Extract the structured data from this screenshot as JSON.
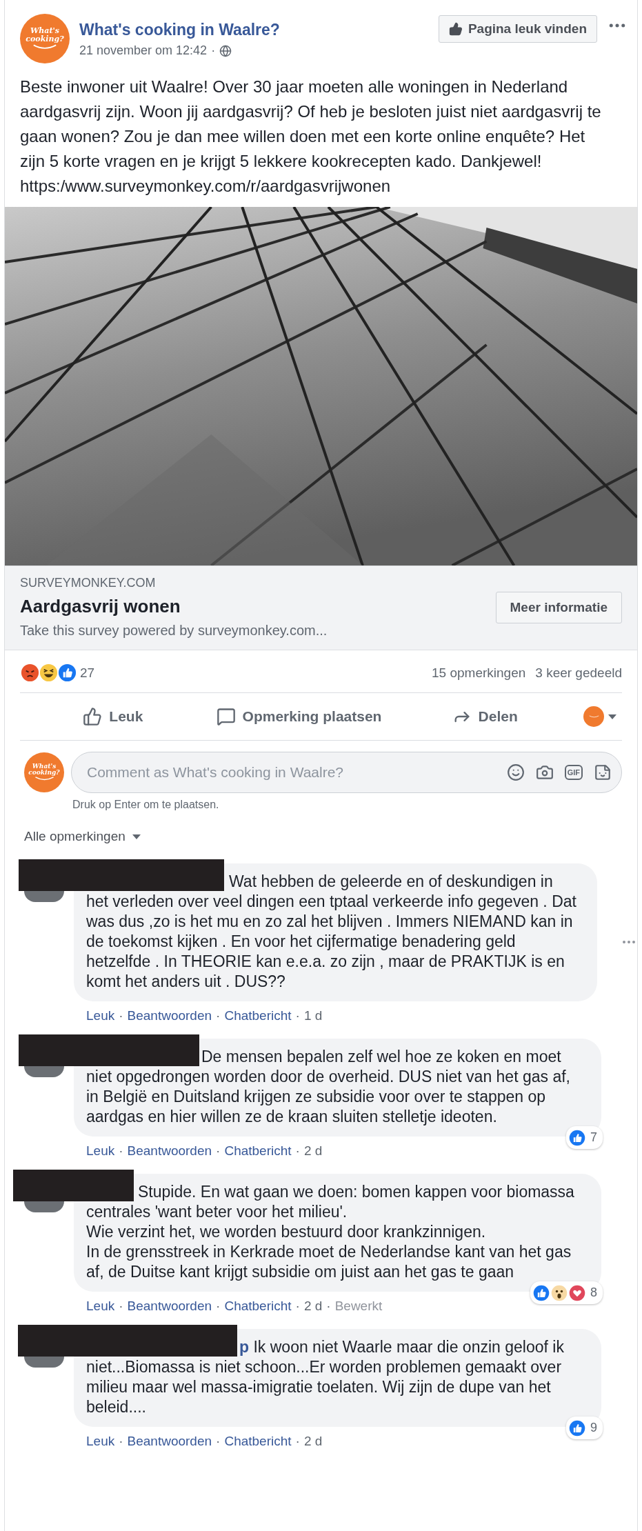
{
  "post": {
    "page_name": "What's cooking in Waalre?",
    "avatar_text": "What's cooking?",
    "date": "21 november om 12:42",
    "separator": "·",
    "like_page_button": "Pagina leuk vinden",
    "text": "Beste inwoner uit Waalre! Over 30 jaar moeten alle woningen in Nederland aardgasvrij zijn. Woon jij aardgasvrij? Of heb je besloten juist niet aardgasvrij te gaan wonen? Zou je dan mee willen doen met een korte online enquête? Het zijn 5 korte vragen en je krijgt 5 lekkere kookrecepten kado. Dankjewel!",
    "url": "https:/www.surveymonkey.com/r/aardgasvrijwonen",
    "link_preview": {
      "domain": "SURVEYMONKEY.COM",
      "title": "Aardgasvrij wonen",
      "description": "Take this survey powered by surveymonkey.com...",
      "button": "Meer informatie"
    },
    "reactions": {
      "kinds": [
        {
          "kind": "angry"
        },
        {
          "kind": "haha"
        },
        {
          "kind": "like"
        }
      ],
      "count": "27"
    },
    "comments_count": "15 opmerkingen",
    "shares_count": "3 keer gedeeld",
    "actions": [
      {
        "kind": "like",
        "label": "Leuk"
      },
      {
        "kind": "comment",
        "label": "Opmerking plaatsen"
      },
      {
        "kind": "share",
        "label": "Delen"
      }
    ]
  },
  "composer": {
    "avatar_text": "What's cooking?",
    "placeholder": "Comment as What's cooking in Waalre?",
    "tools": [
      {
        "kind": "emoji"
      },
      {
        "kind": "camera"
      },
      {
        "kind": "gif",
        "label": "GIF"
      },
      {
        "kind": "sticker"
      }
    ],
    "hint": "Druk op Enter om te plaatsen."
  },
  "filter": {
    "label": "Alle opmerkingen"
  },
  "comments": [
    {
      "redacted": true,
      "menu_visible": true,
      "text": "Wat hebben de geleerde en of deskundigen in het verleden over veel dingen een tptaal verkeerde info gegeven . Dat was dus ,zo is het mu en zo zal het blijven . Immers NIEMAND kan in de toekomst kijken . En voor het cijfermatige benadering geld hetzelfde . In THEORIE kan e.e.a. zo zijn , maar de PRAKTIJK is en komt het anders uit . DUS??",
      "actions": [
        "Leuk",
        "Beantwoorden",
        "Chatbericht"
      ],
      "time": "1 d"
    },
    {
      "redacted": true,
      "menu_visible": false,
      "text": "De mensen bepalen zelf wel hoe ze koken en moet niet opgedrongen worden door de overheid. DUS niet van het gas af, in België en Duitsland krijgen ze subsidie voor over te stappen op aardgas en hier willen ze de kraan sluiten stelletje ideoten.",
      "actions": [
        "Leuk",
        "Beantwoorden",
        "Chatbericht"
      ],
      "time": "2 d",
      "reactions": {
        "kinds": [
          {
            "kind": "like"
          }
        ],
        "count": "7"
      }
    },
    {
      "redacted": true,
      "menu_visible": false,
      "text": "Stupide. En wat gaan we doen: bomen kappen voor biomassa centrales 'want beter voor het milieu'.\nWie verzint het, we worden bestuurd door krankzinnigen.\nIn de grensstreek in Kerkrade moet de Nederlandse kant van het gas af, de Duitse kant krijgt subsidie om juist aan het gas te gaan",
      "actions": [
        "Leuk",
        "Beantwoorden",
        "Chatbericht"
      ],
      "time": "2 d",
      "edited": "Bewerkt",
      "reactions": {
        "kinds": [
          {
            "kind": "like"
          },
          {
            "kind": "wow"
          },
          {
            "kind": "love"
          }
        ],
        "count": "8"
      }
    },
    {
      "redacted": true,
      "menu_visible": false,
      "author": "p",
      "text": "Ik woon niet Waarle maar die onzin geloof ik niet...Biomassa is niet schoon...Er worden problemen gemaakt over milieu maar wel massa-imigratie toelaten. Wij zijn de dupe van het beleid....",
      "actions": [
        "Leuk",
        "Beantwoorden",
        "Chatbericht"
      ],
      "time": "2 d",
      "reactions": {
        "kinds": [
          {
            "kind": "like"
          }
        ],
        "count": "9"
      }
    }
  ]
}
